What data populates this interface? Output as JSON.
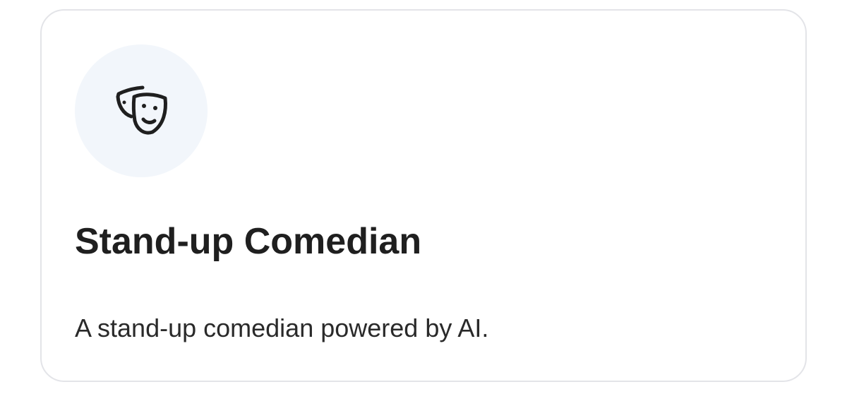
{
  "card": {
    "icon": "theater-masks-icon",
    "title": "Stand-up Comedian",
    "description": "A stand-up comedian powered by AI.",
    "colors": {
      "icon_background": "#f2f6fb",
      "border": "#e3e4e8",
      "text": "#1f1f1f"
    }
  }
}
